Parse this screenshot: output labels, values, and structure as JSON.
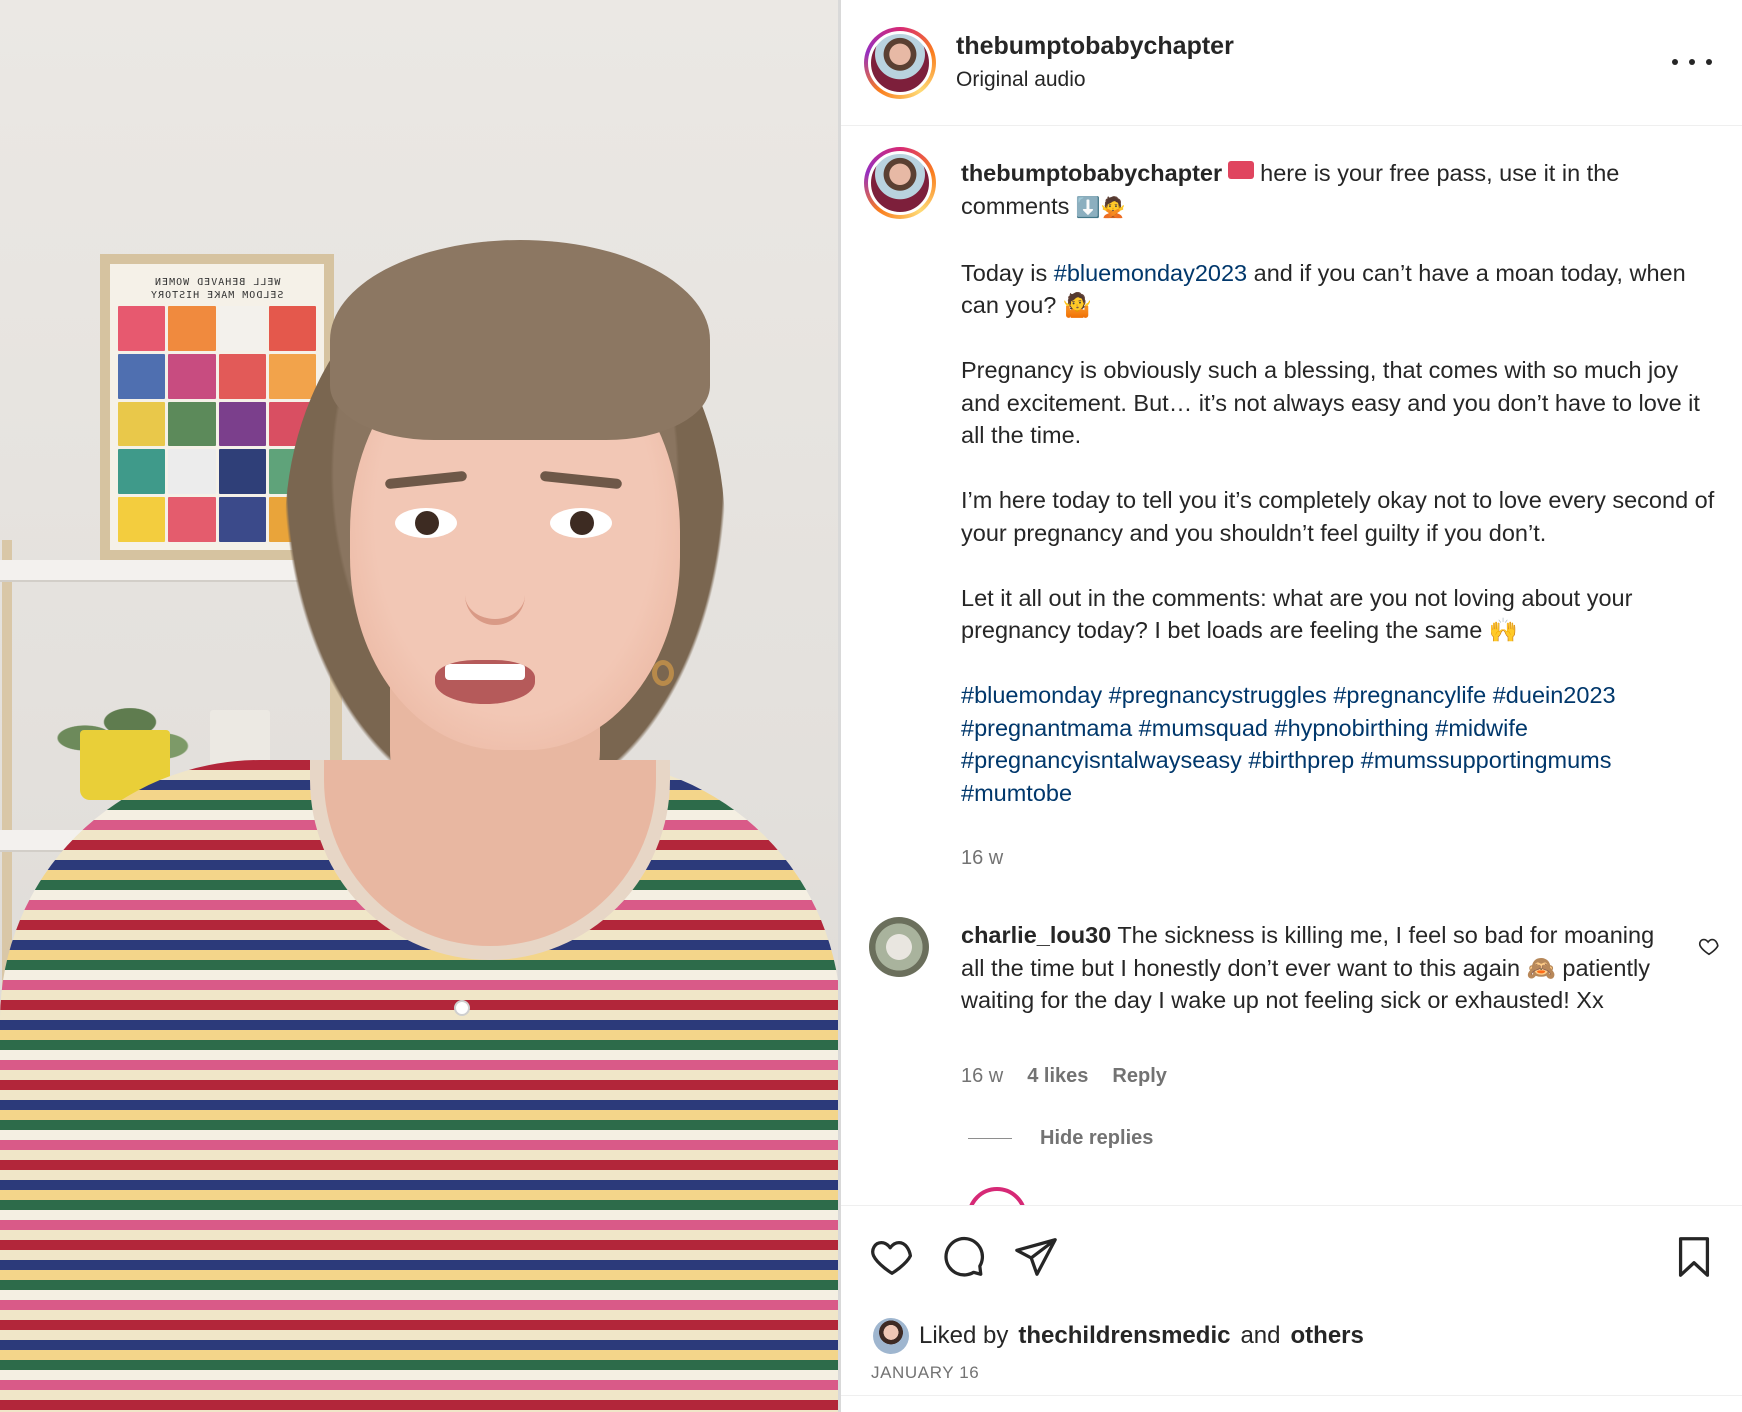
{
  "post": {
    "username": "thebumptobabychapter",
    "audio": "Original audio"
  },
  "caption": {
    "username": "thebumptobabychapter",
    "line1_text": "here is your free pass, use it in the comments",
    "line1_emoji": "⬇️🙅",
    "p2_before": "Today is ",
    "p2_tag": "#bluemonday2023",
    "p2_after": " and if you can’t have a moan today, when can you? 🤷",
    "p3": "Pregnancy is obviously such a blessing, that comes with so much joy and excitement. But… it’s not always easy and you don’t have to love it all the time.",
    "p4": "I’m here today to tell you it’s completely okay not to love every second of your pregnancy and you shouldn’t feel guilty if you don’t.",
    "p5": "Let it all out in the comments: what are you not loving about your pregnancy today? I bet loads are feeling the same 🙌",
    "hashtags": [
      "#bluemonday",
      "#pregnancystruggles",
      "#pregnancylife",
      "#duein2023",
      "#pregnantmama",
      "#mumsquad",
      "#hypnobirthing",
      "#midwife",
      "#pregnancyisntalwayseasy",
      "#birthprep",
      "#mumssupportingmums",
      "#mumtobe"
    ],
    "time": "16 w"
  },
  "comment": {
    "username": "charlie_lou30",
    "text": "The sickness is killing me, I feel so bad for moaning all the time but I honestly don’t ever want to this again 🙈 patiently waiting for the day I wake up not feeling sick or exhausted! Xx",
    "time": "16 w",
    "likes": "4 likes",
    "reply_label": "Reply",
    "hide_replies": "Hide replies"
  },
  "footer": {
    "liked_prefix": "Liked by",
    "liked_user": "thechildrensmedic",
    "liked_and": "and",
    "liked_others": "others",
    "date": "JANUARY 16"
  },
  "poster": {
    "title_line1": "WELL BEHAVED WOMEN",
    "title_line2": "SELDOM MAKE HISTORY"
  },
  "colors": {
    "hashtag": "#00376b",
    "secondary_text": "#737373",
    "primary_text": "#262626"
  },
  "icons": [
    "more-icon",
    "heart-icon",
    "comment-icon",
    "share-icon",
    "bookmark-icon",
    "small-heart-icon"
  ]
}
